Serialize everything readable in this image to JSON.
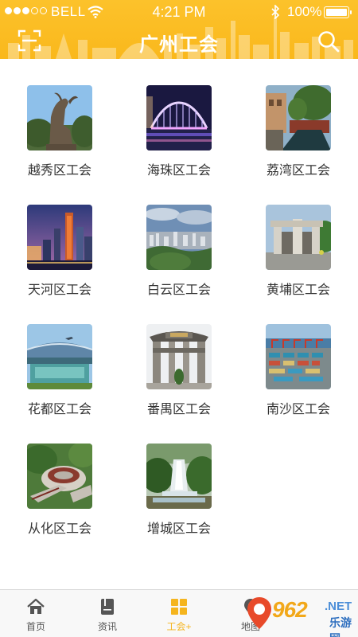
{
  "status": {
    "carrier": "BELL",
    "time": "4:21 PM",
    "battery": "100%"
  },
  "header": {
    "title": "广州工会"
  },
  "districts": [
    {
      "label": "越秀区工会",
      "icon": "goat-statue"
    },
    {
      "label": "海珠区工会",
      "icon": "lit-bridge"
    },
    {
      "label": "荔湾区工会",
      "icon": "canal-street"
    },
    {
      "label": "天河区工会",
      "icon": "night-skyline"
    },
    {
      "label": "白云区工会",
      "icon": "city-overview"
    },
    {
      "label": "黄埔区工会",
      "icon": "stone-gate"
    },
    {
      "label": "花都区工会",
      "icon": "airport-terminal"
    },
    {
      "label": "番禺区工会",
      "icon": "memorial-archway"
    },
    {
      "label": "南沙区工会",
      "icon": "container-port"
    },
    {
      "label": "从化区工会",
      "icon": "round-building"
    },
    {
      "label": "增城区工会",
      "icon": "waterfall"
    }
  ],
  "tabs": [
    {
      "label": "首页",
      "icon": "home-icon",
      "active": false
    },
    {
      "label": "资讯",
      "icon": "book-icon",
      "active": false
    },
    {
      "label": "工会+",
      "icon": "grid-icon",
      "active": true
    },
    {
      "label": "地图",
      "icon": "map-icon",
      "active": false
    }
  ],
  "watermark": {
    "brand": "962",
    "domain": ".NET",
    "sub": "乐游网"
  },
  "colors": {
    "header": "#fab81c",
    "active_tab": "#f5b51e",
    "text": "#333333"
  }
}
